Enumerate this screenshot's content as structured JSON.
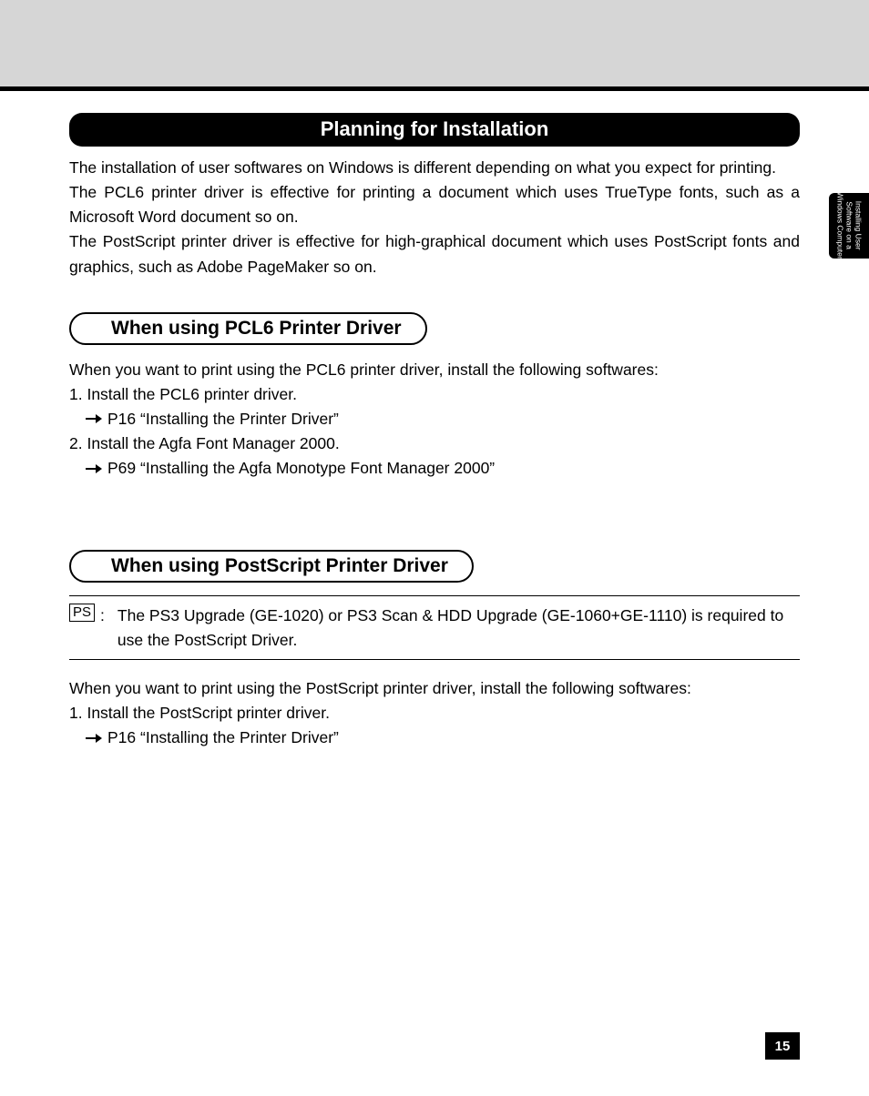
{
  "main_title": "Planning for Installation",
  "intro": {
    "p1": "The installation of user softwares on Windows is different depending on what you expect for printing.",
    "p2": "The PCL6 printer driver is effective for printing a document which uses TrueType fonts, such as a Microsoft Word document so on.",
    "p3": "The PostScript printer driver is effective for high-graphical document which uses PostScript fonts and graphics, such as Adobe PageMaker so on."
  },
  "pcl6": {
    "title": "When using PCL6 Printer Driver",
    "lead": "When you want to print using the PCL6 printer driver, install the following softwares:",
    "step1": "1. Install the PCL6 printer driver.",
    "ref1": "P16 “Installing the Printer Driver”",
    "step2": "2. Install the Agfa Font Manager 2000.",
    "ref2": "P69 “Installing the Agfa Monotype Font Manager 2000”"
  },
  "postscript": {
    "title": "When using PostScript Printer Driver",
    "ps_label": "PS",
    "ps_colon": ":",
    "ps_note": "The PS3 Upgrade (GE-1020) or PS3 Scan & HDD Upgrade (GE-1060+GE-1110) is required to use the PostScript Driver.",
    "lead": "When you want to print using the PostScript printer driver, install the following softwares:",
    "step1": "1. Install the PostScript printer driver.",
    "ref1": "P16 “Installing the Printer Driver”"
  },
  "side_tab": "Installing User\nSoftware on a\nWindows Computer",
  "page_number": "15"
}
